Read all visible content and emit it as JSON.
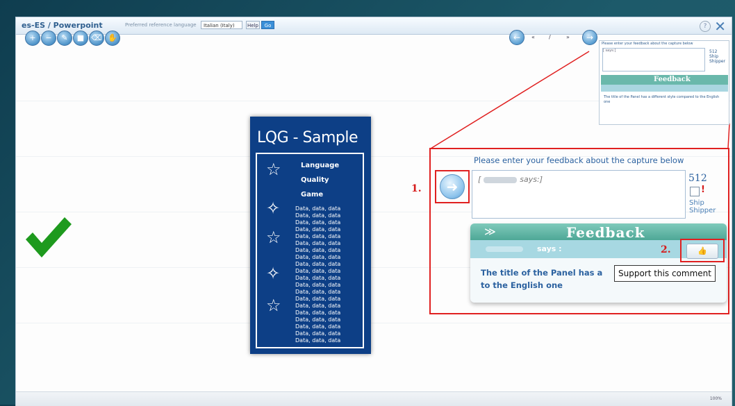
{
  "window": {
    "title": "es-ES / Powerpoint",
    "pref_lang_label": "Preferred reference language",
    "pref_lang_value": "Italian (Italy)",
    "help_label": "Help",
    "go_label": "Go",
    "help_icon": "question-icon",
    "close_icon": "close-icon"
  },
  "toolbar": {
    "tools": [
      "zoom-in-icon",
      "zoom-out-icon",
      "pencil-icon",
      "square-icon",
      "eraser-icon",
      "pan-icon"
    ]
  },
  "navigation": {
    "prev_icon": "arrow-left-icon",
    "first": "«",
    "sep": "/",
    "last": "»",
    "next_icon": "arrow-right-icon"
  },
  "lqg_card": {
    "title": "LQG - Sample",
    "heading_lines": [
      "Language",
      "Quality",
      "Game"
    ],
    "data_lines": "Data, data, data"
  },
  "feedback": {
    "prompt": "Please enter your feedback about the capture below",
    "says_prefix": "[",
    "says_suffix": "says:]",
    "char_count": "512",
    "ship_label": "Ship",
    "shipper_label": "Shipper",
    "panel_title": "Feedback",
    "says_label": "says :",
    "comment_text_line1": "The title of the Panel has a",
    "comment_text_line2": "to the English one",
    "tooltip": "Support this comment",
    "step1": "1.",
    "step2": "2."
  },
  "mini_panel": {
    "prompt": "Please enter your feedback about the capture below",
    "says": "[ says:]",
    "count": "512",
    "ship": "Ship",
    "shipper": "Shipper",
    "title": "Feedback",
    "says_label": "says :",
    "comment": "The title of the Panel has a different style compared to the English one"
  },
  "status": {
    "zoom": "100%"
  },
  "colors": {
    "accent": "#3a8fd8",
    "card_blue": "#0d3f86",
    "feedback_green": "#4ea796",
    "highlight_red": "#e02020",
    "check_green": "#1e9a1e"
  }
}
